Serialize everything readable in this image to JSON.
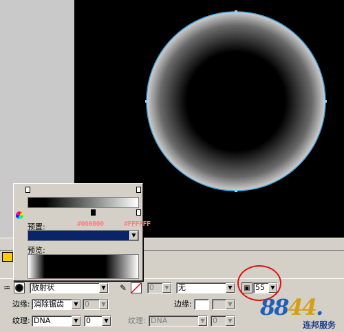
{
  "gradient_editor": {
    "preset_label": "预置:",
    "start_color": "#000000",
    "end_color": "#FFFFFF",
    "preview_label": "预览:"
  },
  "fill": {
    "type_value": "放射状",
    "edge_label": "边缘:",
    "edge_value": "消除锯齿",
    "edge_number": "0",
    "texture_label": "纹理:",
    "texture_value": "DNA",
    "texture_number": "0"
  },
  "stroke": {
    "size_value": "0",
    "type_value": "无",
    "edge_label": "边缘:",
    "texture_label": "纹理:",
    "texture_value": "DNA",
    "texture_number": "0"
  },
  "effects": {
    "value": "55"
  },
  "watermark": {
    "logo_a": "88",
    "logo_b": "44",
    "logo_c": ".",
    "subtitle": "连邦服务"
  },
  "colors": {
    "circle_stroke": "#3aa0d8",
    "circle_center": "#000000",
    "circle_edge": "#c8c8c8",
    "highlight_ring": "#e01010"
  }
}
